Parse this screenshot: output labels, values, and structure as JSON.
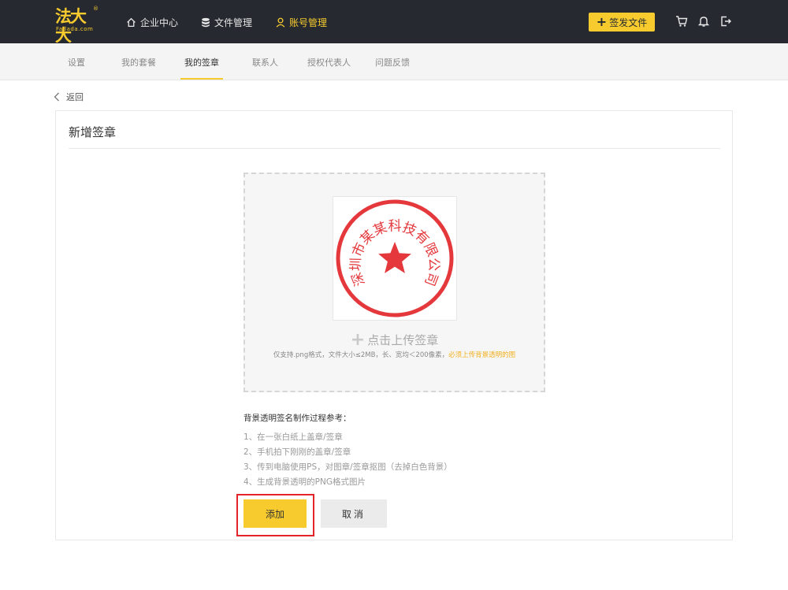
{
  "brand": {
    "logo_text": "法大大",
    "logo_sub": "Fadada.com",
    "logo_mark": "®",
    "accent_color": "#f7cb2d",
    "topbar_color": "#262a30"
  },
  "topnav": {
    "items": [
      {
        "label": "企业中心",
        "icon": "home-icon"
      },
      {
        "label": "文件管理",
        "icon": "database-icon"
      },
      {
        "label": "账号管理",
        "icon": "user-icon",
        "active": true
      }
    ],
    "sign_button": "签发文件",
    "icons": [
      "cart-icon",
      "bell-icon",
      "logout-icon"
    ]
  },
  "subnav": {
    "tabs": [
      {
        "label": "设置"
      },
      {
        "label": "我的套餐"
      },
      {
        "label": "我的签章",
        "active": true
      },
      {
        "label": "联系人"
      },
      {
        "label": "授权代表人"
      },
      {
        "label": "问题反馈"
      }
    ]
  },
  "back_label": "返回",
  "card": {
    "title": "新增签章",
    "seal": {
      "text": "深圳市某某科技有限公司",
      "color": "#e4383c"
    },
    "upload_label": "点击上传签章",
    "upload_hint": "仅支持.png格式，文件大小≤2MB，长、宽均＜200像素，",
    "upload_hint_warn": "必须上传背景透明的图",
    "steps_title": "背景透明签名制作过程参考：",
    "steps": [
      "1、在一张白纸上盖章/签章",
      "2、手机拍下刚刚的盖章/签章",
      "3、传到电脑使用PS，对图章/签章抠图（去掉白色背景）",
      "4、生成背景透明的PNG格式图片"
    ],
    "add_button": "添加",
    "cancel_button": "取消"
  }
}
